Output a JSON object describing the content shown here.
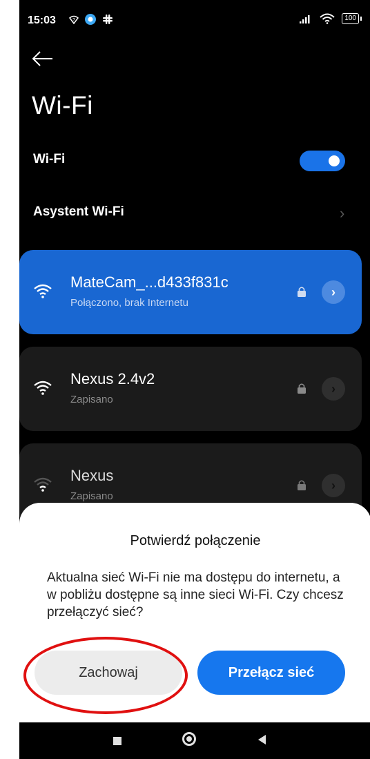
{
  "status_bar": {
    "time": "15:03",
    "battery": "100"
  },
  "page": {
    "title": "Wi-Fi"
  },
  "settings": {
    "wifi_label": "Wi-Fi",
    "wifi_enabled": true,
    "assistant_label": "Asystent Wi-Fi"
  },
  "networks": [
    {
      "name": "MateCam_...d433f831c",
      "status": "Połączono, brak Internetu",
      "connected": true,
      "secured": true
    },
    {
      "name": "Nexus 2.4v2",
      "status": "Zapisano",
      "connected": false,
      "secured": true
    },
    {
      "name": "Nexus",
      "status": "Zapisano",
      "connected": false,
      "secured": true
    }
  ],
  "dialog": {
    "title": "Potwierdź połączenie",
    "message": "Aktualna sieć Wi-Fi nie ma dostępu do internetu, a w pobliżu dostępne są inne sieci Wi-Fi. Czy chcesz przełączyć sieć?",
    "keep_label": "Zachowaj",
    "switch_label": "Przełącz sieć"
  },
  "colors": {
    "accent": "#1677ee",
    "connected_card": "#1967d2",
    "annotation": "#e01010"
  },
  "icons": {
    "back": "arrow-left-icon",
    "wifi": "wifi-icon",
    "lock": "lock-icon",
    "detail": "chevron-right-icon"
  }
}
